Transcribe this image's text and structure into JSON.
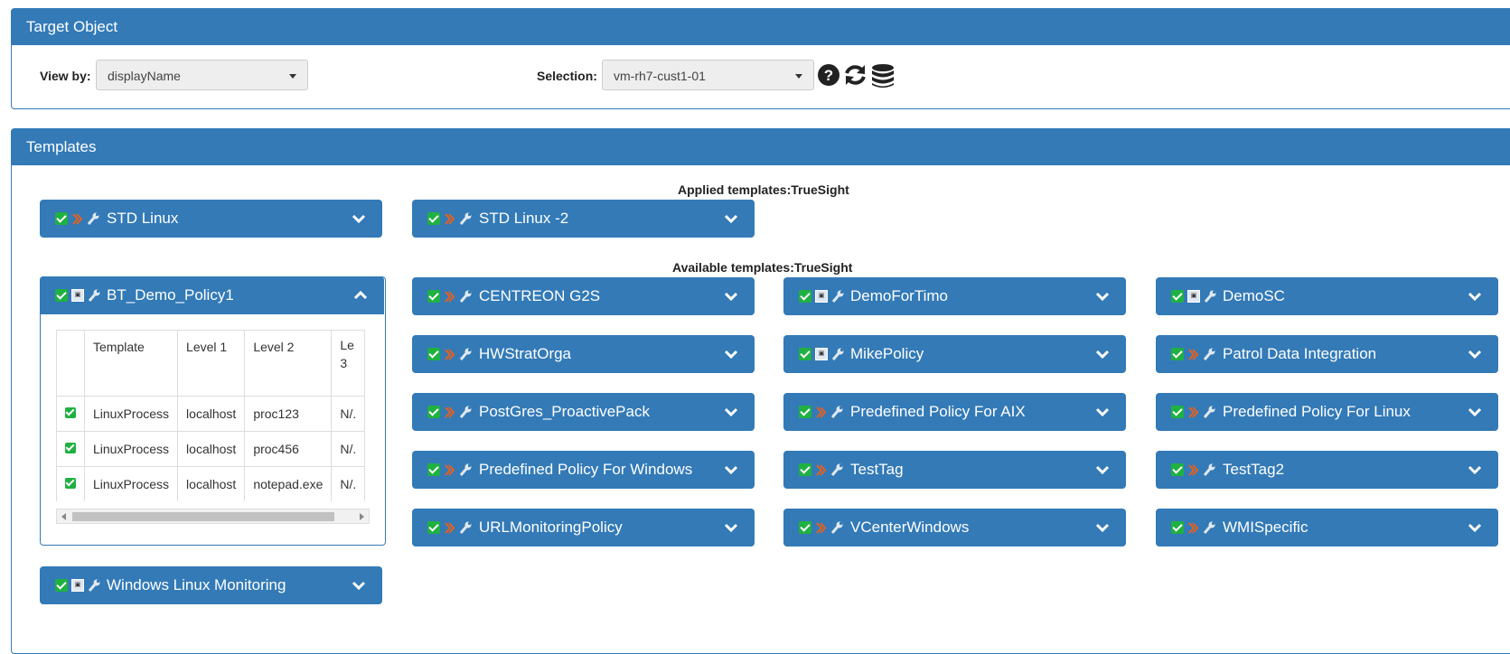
{
  "target": {
    "title": "Target Object",
    "view_by_label": "View by:",
    "view_by_value": "displayName",
    "selection_label": "Selection:",
    "selection_value": "vm-rh7-cust1-01",
    "icons": [
      "question-circle-icon",
      "refresh-icon",
      "database-icon"
    ]
  },
  "templates": {
    "title": "Templates",
    "applied_title": "Applied templates:TrueSight",
    "available_title": "Available templates:TrueSight",
    "left_column": [
      {
        "name": "STD Linux",
        "type": "arrows",
        "expanded": false
      },
      {
        "name": "BT_Demo_Policy1",
        "type": "box",
        "expanded": true
      },
      {
        "name": "Windows Linux Monitoring",
        "type": "box",
        "expanded": false
      }
    ],
    "applied": [
      {
        "name": "STD Linux -2",
        "type": "arrows"
      }
    ],
    "available": [
      {
        "name": "CENTREON G2S",
        "type": "arrows"
      },
      {
        "name": "DemoForTimo",
        "type": "box"
      },
      {
        "name": "DemoSC",
        "type": "box"
      },
      {
        "name": "HWStratOrga",
        "type": "arrows"
      },
      {
        "name": "MikePolicy",
        "type": "box"
      },
      {
        "name": "Patrol Data Integration",
        "type": "arrows"
      },
      {
        "name": "PostGres_ProactivePack",
        "type": "arrows"
      },
      {
        "name": "Predefined Policy For AIX",
        "type": "arrows"
      },
      {
        "name": "Predefined Policy For Linux",
        "type": "arrows"
      },
      {
        "name": "Predefined Policy For Windows",
        "type": "arrows"
      },
      {
        "name": "TestTag",
        "type": "arrows"
      },
      {
        "name": "TestTag2",
        "type": "arrows"
      },
      {
        "name": "URLMonitoringPolicy",
        "type": "arrows"
      },
      {
        "name": "VCenterWindows",
        "type": "arrows"
      },
      {
        "name": "WMISpecific",
        "type": "arrows"
      }
    ],
    "detail_table": {
      "headers": [
        "",
        "Template",
        "Level 1",
        "Level 2",
        "Le\n3"
      ],
      "rows": [
        [
          "check",
          "LinuxProcess",
          "localhost",
          "proc123",
          "N/."
        ],
        [
          "check",
          "LinuxProcess",
          "localhost",
          "proc456",
          "N/."
        ],
        [
          "check",
          "LinuxProcess",
          "localhost",
          "notepad.exe",
          "N/."
        ]
      ]
    }
  },
  "colors": {
    "panel_blue": "#337ab7",
    "check_green": "#1fb141",
    "arrow_orange": "#e8601c"
  }
}
